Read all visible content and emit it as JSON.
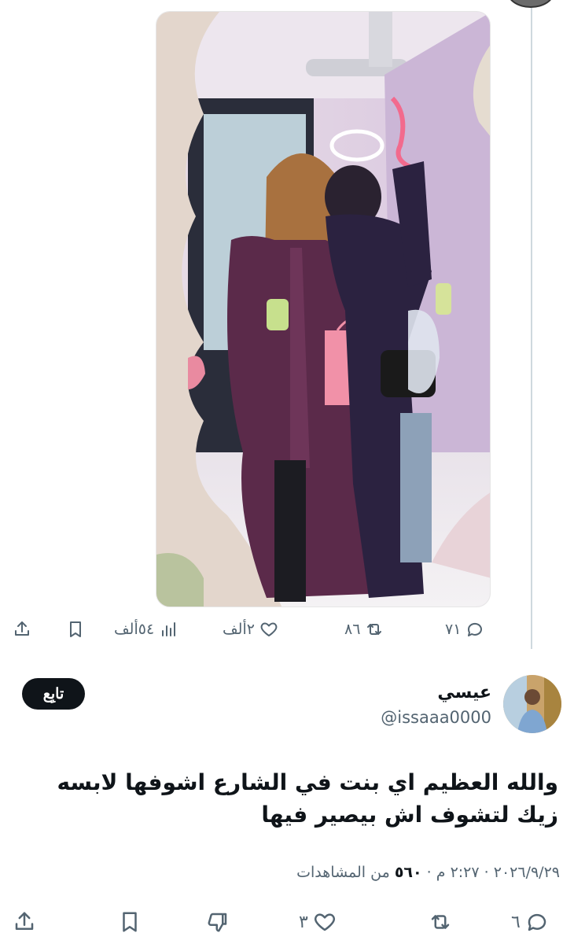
{
  "first_tweet": {
    "stats": {
      "replies": "٧١",
      "retweets": "٨٦",
      "likes": "٢ألف",
      "views": "٥٤ألف"
    }
  },
  "reply": {
    "name": "عيسي",
    "handle": "@issaaa0000",
    "follow_label": "تابِع",
    "text": "والله العظيم اي بنت في الشارع اشوفها لابسه زيك لتشوف اش بيصير فيها",
    "date": "٢٠٢٦/٩/٢٩",
    "time": "٢:٢٧ م",
    "views_count": "٥٦٠",
    "views_label": "من المشاهدات",
    "stats": {
      "replies": "٦",
      "likes": "٣"
    }
  },
  "colors": {
    "text": "#0f1419",
    "muted": "#536471",
    "follow_bg": "#0f1419"
  }
}
